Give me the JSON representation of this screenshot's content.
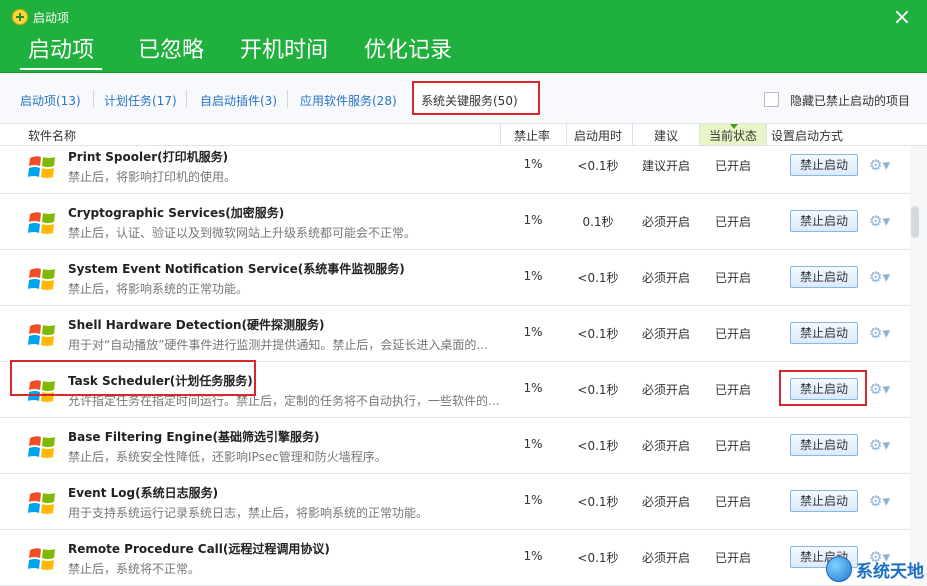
{
  "window": {
    "title": "启动项",
    "close_glyph": "×"
  },
  "main_tabs": [
    {
      "label": "启动项",
      "active": true
    },
    {
      "label": "已忽略",
      "active": false
    },
    {
      "label": "开机时间",
      "active": false
    },
    {
      "label": "优化记录",
      "active": false
    }
  ],
  "sub_tabs": [
    {
      "label": "启动项(13)"
    },
    {
      "label": "计划任务(17)"
    },
    {
      "label": "自启动插件(3)"
    },
    {
      "label": "应用软件服务(28)"
    },
    {
      "label": "系统关键服务(50)",
      "active": true
    }
  ],
  "hide_disabled": {
    "label": "隐藏已禁止启动的项目",
    "checked": false
  },
  "columns": {
    "name": "软件名称",
    "disable_rate": "禁止率",
    "boot_time": "启动用时",
    "advice": "建议",
    "state": "当前状态",
    "action": "设置启动方式"
  },
  "rows": [
    {
      "name": "Print Spooler(打印机服务)",
      "desc": "禁止后，将影响打印机的使用。",
      "rate": "1%",
      "time": "<0.1秒",
      "advice": "建议开启",
      "state": "已开启",
      "action": "禁止启动",
      "gear": "⚙▾"
    },
    {
      "name": "Cryptographic Services(加密服务)",
      "desc": "禁止后，认证、验证以及到微软网站上升级系统都可能会不正常。",
      "rate": "1%",
      "time": "0.1秒",
      "advice": "必须开启",
      "state": "已开启",
      "action": "禁止启动",
      "gear": "⚙▾"
    },
    {
      "name": "System Event Notification Service(系统事件监视服务)",
      "desc": "禁止后，将影响系统的正常功能。",
      "rate": "1%",
      "time": "<0.1秒",
      "advice": "必须开启",
      "state": "已开启",
      "action": "禁止启动",
      "gear": "⚙▾"
    },
    {
      "name": "Shell Hardware Detection(硬件探测服务)",
      "desc": "用于对“自动播放”硬件事件进行监测并提供通知。禁止后，会延长进入桌面的...",
      "rate": "1%",
      "time": "<0.1秒",
      "advice": "必须开启",
      "state": "已开启",
      "action": "禁止启动",
      "gear": "⚙▾"
    },
    {
      "name": "Task Scheduler(计划任务服务)",
      "desc": "允许指定任务在指定时间运行。禁止后，定制的任务将不自动执行，一些软件的...",
      "rate": "1%",
      "time": "<0.1秒",
      "advice": "必须开启",
      "state": "已开启",
      "action": "禁止启动",
      "gear": "⚙▾"
    },
    {
      "name": "Base Filtering Engine(基础筛选引擎服务)",
      "desc": "禁止后，系统安全性降低，还影响IPsec管理和防火墙程序。",
      "rate": "1%",
      "time": "<0.1秒",
      "advice": "必须开启",
      "state": "已开启",
      "action": "禁止启动",
      "gear": "⚙▾"
    },
    {
      "name": "Event Log(系统日志服务)",
      "desc": "用于支持系统运行记录系统日志，禁止后，将影响系统的正常功能。",
      "rate": "1%",
      "time": "<0.1秒",
      "advice": "必须开启",
      "state": "已开启",
      "action": "禁止启动",
      "gear": "⚙▾"
    },
    {
      "name": "Remote Procedure Call(远程过程调用协议)",
      "desc": "禁止后，系统将不正常。",
      "rate": "1%",
      "time": "<0.1秒",
      "advice": "必须开启",
      "state": "已开启",
      "action": "禁止启动",
      "gear": "⚙▾"
    }
  ],
  "watermark": {
    "text": "系统天地"
  },
  "colors": {
    "header_green": "#20b03d",
    "link_blue": "#2a73c7",
    "highlight_red": "#d9272e",
    "sort_column_bg": "#e6f6c7"
  }
}
